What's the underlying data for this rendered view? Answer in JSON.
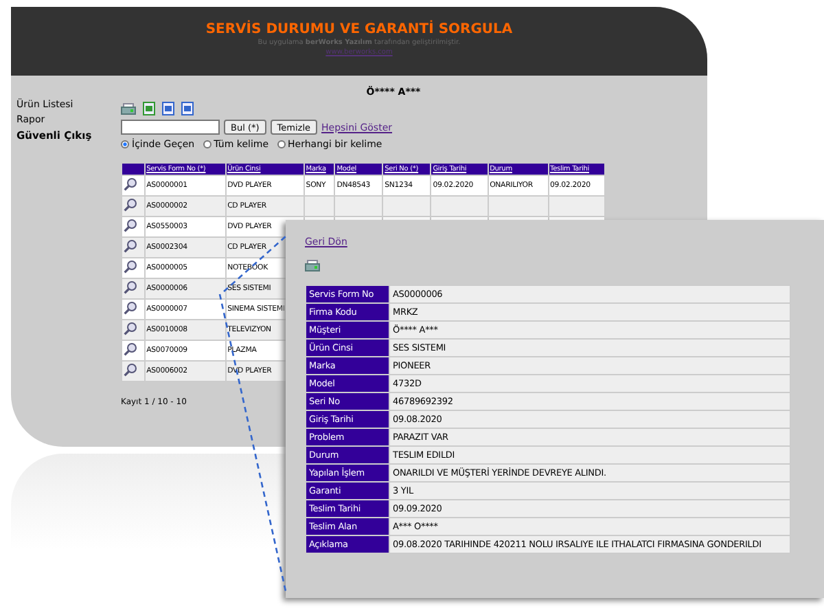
{
  "header": {
    "title": "SERVİS DURUMU VE GARANTİ SORGULA",
    "subtitle": "Bu uygulama **berWorks Yazılım** tarafından geliştirilmiştir.",
    "link": "www.berworks.com"
  },
  "sidebar": {
    "items": [
      {
        "label": "Ürün Listesi",
        "kind": "link"
      },
      {
        "label": "Rapor",
        "kind": "link"
      },
      {
        "label": "Güvenli Çıkış",
        "kind": "exit"
      }
    ]
  },
  "user_name": "Ö**** A***",
  "search": {
    "buttons": [
      "Bul  (*)",
      "Temizle"
    ],
    "link": "Hepsini Göster",
    "options": [
      {
        "label": "İçinde Geçen",
        "selected": true
      },
      {
        "label": "Tüm kelime",
        "selected": false
      },
      {
        "label": "Herhangi bir kelime",
        "selected": false
      }
    ]
  },
  "table": {
    "columns": [
      "Servis Form No (*)",
      "Ürün Cinsi",
      "Marka",
      "Model",
      "Seri No (*)",
      "Giriş Tarihi",
      "Durum",
      "Teslim Tarihi"
    ],
    "rows": [
      {
        "cells": [
          "AS0000001",
          "DVD PLAYER",
          "SONY",
          "DN48543",
          "SN1234",
          "09.02.2020",
          "ONARILIYOR",
          "09.02.2020"
        ]
      },
      {
        "cells": [
          "AS0000002",
          "CD PLAYER"
        ]
      },
      {
        "cells": [
          "AS0550003",
          "DVD PLAYER"
        ]
      },
      {
        "cells": [
          "AS0002304",
          "CD PLAYER"
        ]
      },
      {
        "cells": [
          "AS0000005",
          "NOTEBOOK"
        ]
      },
      {
        "cells": [
          "AS0000006",
          "SES SISTEMI"
        ]
      },
      {
        "cells": [
          "AS0000007",
          "SINEMA SISTEMI"
        ]
      },
      {
        "cells": [
          "AS0010008",
          "TELEVIZYON"
        ]
      },
      {
        "cells": [
          "AS0070009",
          "PLAZMA"
        ]
      },
      {
        "cells": [
          "AS0006002",
          "DVD PLAYER"
        ]
      }
    ]
  },
  "pager": "Kayıt 1 / 10 - 10",
  "detail": {
    "back_link": "Geri Dön",
    "fields": [
      {
        "label": "Servis Form No",
        "value": "AS0000006"
      },
      {
        "label": "Firma Kodu",
        "value": "MRKZ"
      },
      {
        "label": "Müşteri",
        "value": "Ö**** A***"
      },
      {
        "label": "Ürün Cinsi",
        "value": "SES SISTEMI"
      },
      {
        "label": "Marka",
        "value": "PIONEER"
      },
      {
        "label": "Model",
        "value": "4732D"
      },
      {
        "label": "Seri No",
        "value": "46789692392"
      },
      {
        "label": "Giriş Tarihi",
        "value": "09.08.2020"
      },
      {
        "label": "Problem",
        "value": "PARAZIT VAR"
      },
      {
        "label": "Durum",
        "value": "TESLIM EDILDI"
      },
      {
        "label": "Yapılan İşlem",
        "value": "ONARILDI VE MÜŞTERİ YERİNDE DEVREYE ALINDI."
      },
      {
        "label": "Garanti",
        "value": "3 YIL"
      },
      {
        "label": "Teslim Tarihi",
        "value": "09.09.2020"
      },
      {
        "label": "Teslim Alan",
        "value": "A*** O****"
      },
      {
        "label": "Açıklama",
        "value": "09.08.2020 TARIHINDE 420211 NOLU IRSALIYE ILE ITHALATCI FIRMASINA GONDERILDI"
      }
    ]
  }
}
